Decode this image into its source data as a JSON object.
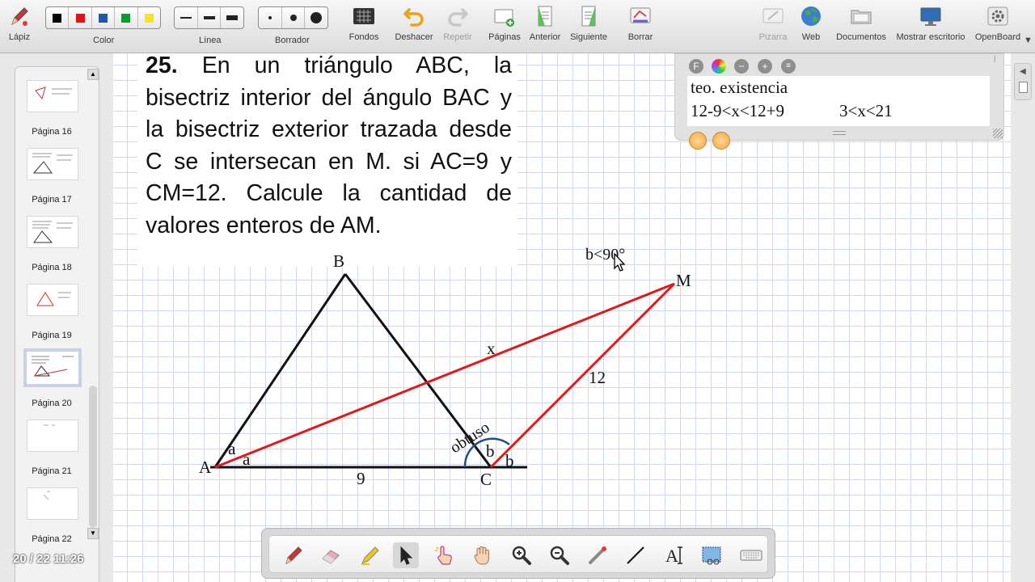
{
  "toolbar": {
    "pen": "Lápiz",
    "color": "Color",
    "line": "Línea",
    "eraser": "Borrador",
    "backgrounds": "Fondos",
    "undo": "Deshacer",
    "redo": "Repetir",
    "pages": "Páginas",
    "previous": "Anterior",
    "next": "Siguiente",
    "erase": "Borrar",
    "board": "Pizarra",
    "web": "Web",
    "documents": "Documentos",
    "show_desktop": "Mostrar escritorio",
    "app": "OpenBoard",
    "colors": [
      "#000000",
      "#e41414",
      "#1a5aa8",
      "#0b9b33",
      "#f6e51d"
    ]
  },
  "sidebar": {
    "pages": [
      {
        "label": "Página 16"
      },
      {
        "label": "Página 17"
      },
      {
        "label": "Página 18"
      },
      {
        "label": "Página 19"
      },
      {
        "label": "Página 20"
      },
      {
        "label": "Página 21"
      },
      {
        "label": "Página 22"
      }
    ],
    "status": "20 / 22 11:26"
  },
  "problem": {
    "number": "25.",
    "text": "En un triángulo ABC, la bisectriz interior del ángulo BAC y la bisectriz exterior trazada desde C se intersecan en M. si AC=9 y CM=12. Calcule la cantidad de valores enteros de AM."
  },
  "figure": {
    "labels": {
      "A": "A",
      "B": "B",
      "C": "C",
      "M": "M",
      "x": "x",
      "cm": "12",
      "ac": "9",
      "a1": "a",
      "a2": "a",
      "b1": "b",
      "b2": "b",
      "obtuse": "obtuso",
      "b_condition": "b<90°"
    },
    "colors": {
      "triangle": "#111111",
      "red": "#e01a1a",
      "arc": "#1f4f8f"
    }
  },
  "note": {
    "line1": "teo. existencia",
    "line2_a": "12-9<x<12+9",
    "line2_b": "3<x<21"
  }
}
